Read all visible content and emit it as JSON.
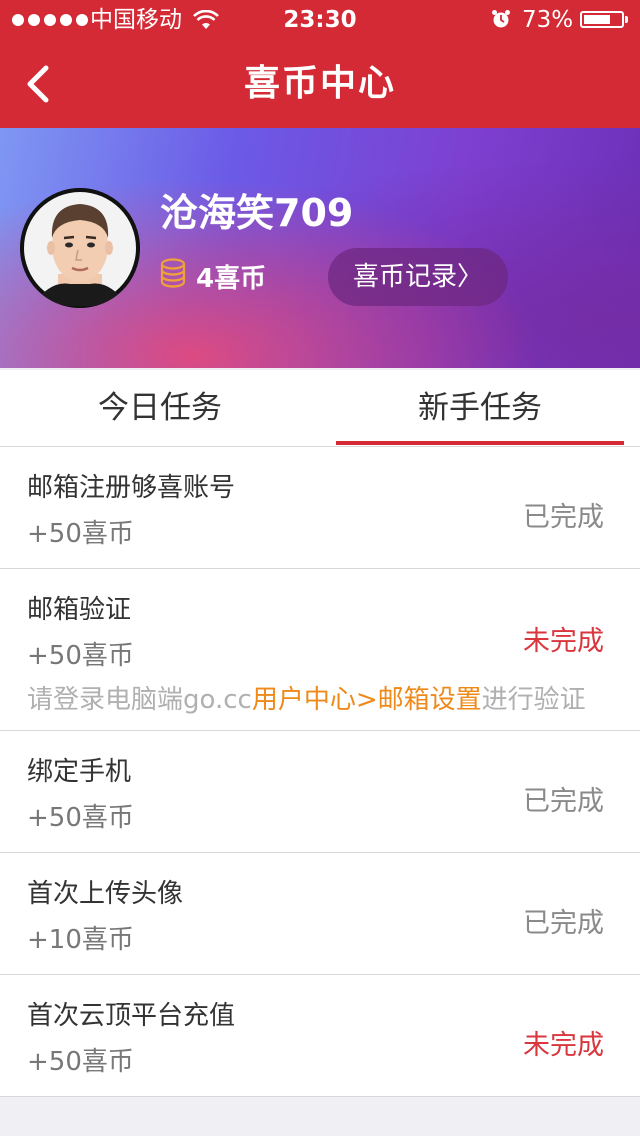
{
  "status_bar": {
    "carrier": "中国移动",
    "time": "23:30",
    "battery": "73%",
    "battery_level": 0.73
  },
  "nav": {
    "title": "喜币中心",
    "back_icon": "chevron-left-icon"
  },
  "profile": {
    "username": "沧海笑709",
    "coins": "4喜币",
    "coin_icon": "coin-stack-icon",
    "record_button": "喜币记录〉"
  },
  "tabs": [
    {
      "label": "今日任务",
      "active": false
    },
    {
      "label": "新手任务",
      "active": true
    }
  ],
  "tasks": [
    {
      "title": "邮箱注册够喜账号",
      "reward": "+50喜币",
      "status": "已完成",
      "done": true
    },
    {
      "title": "邮箱验证",
      "reward": "+50喜币",
      "status": "未完成",
      "done": false,
      "hint": {
        "prefix": "请登录电脑端go.cc",
        "link": "用户中心>邮箱设置",
        "suffix": "进行验证"
      }
    },
    {
      "title": "绑定手机",
      "reward": "+50喜币",
      "status": "已完成",
      "done": true
    },
    {
      "title": "首次上传头像",
      "reward": "+10喜币",
      "status": "已完成",
      "done": true
    },
    {
      "title": "首次云顶平台充值",
      "reward": "+50喜币",
      "status": "未完成",
      "done": false
    }
  ],
  "colors": {
    "brand_red": "#d42a35",
    "undone_red": "#d9363e",
    "done_gray": "#8a8a8a",
    "hint_orange": "#ef8a1a"
  }
}
